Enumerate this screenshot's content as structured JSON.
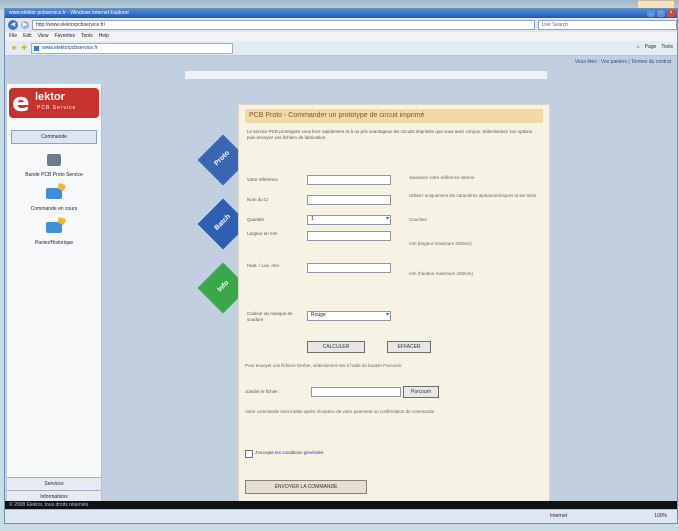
{
  "browser": {
    "title": "www.elektor-pcbservice.fr - Windows Internet Explorer",
    "address": "http://www.elektorpcbservice.fr/",
    "search_placeholder": "Live Search",
    "menu": [
      "File",
      "Edit",
      "View",
      "Favorites",
      "Tools",
      "Help"
    ],
    "tab_label": "www.elektorpcbservice.fr",
    "tools": [
      "Page",
      "Tools"
    ]
  },
  "page": {
    "top_links": "Vous êtes : Vos paniers  |  Termes du contrat",
    "logo": {
      "letter": "e",
      "name": "lektor",
      "sub": "PCB Service"
    },
    "sidebar": {
      "section": "Commande",
      "items": [
        "Bande PCB Proto Service",
        "Commande en cours",
        "Panier/Historique"
      ],
      "bottom": [
        "Services",
        "Informations"
      ]
    },
    "diamond_labels": [
      "Proto",
      "Batch",
      "Info"
    ],
    "form": {
      "title": "PCB Proto - Commander un prototype de circuit imprimé",
      "intro": "Le service PCB prototypes vous livre rapidement et à un prix avantageux les circuits imprimés que vous avez conçus. Sélectionnez vos options puis envoyez vos fichiers de fabrication.",
      "labels": [
        "Votre référence",
        "Nom du CI",
        "Quantité",
        "Largeur en mm",
        "Haut. / Lon. mm",
        "Couleur du masque de soudure",
        "Joindre le fichier :"
      ],
      "hints": [
        "Saisissez votre référence interne",
        "Utilisez uniquement les caractères alphanumériques et les tirets",
        "Couches",
        "mm (largeur maximum 425mm)",
        "mm (hauteur maximum 425mm)"
      ],
      "quantity": "1",
      "color": "Rouge",
      "buttons": [
        "CALCULER",
        "EFFACER"
      ],
      "upload_note": "Pour envoyer vos fichiers Gerber, sélectionnez-les à l'aide du bouton Parcourir.",
      "browse": "Parcourir",
      "vat_note": "Votre commande sera traitée après réception de votre paiement ou confirmation de commande.",
      "accept": "J'accepte les conditions générales",
      "send": "ENVOYER LA COMMANDE"
    },
    "footer": "© 2008 Elektor, tous droits réservés",
    "status": {
      "zone": "Internet",
      "zoom": "100%"
    }
  }
}
